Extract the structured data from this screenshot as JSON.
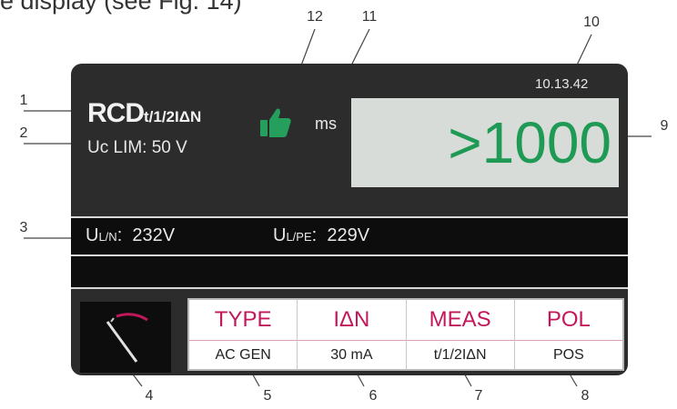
{
  "heading": "e display (see Fig. 14)",
  "callouts": [
    "1",
    "2",
    "3",
    "4",
    "5",
    "6",
    "7",
    "8",
    "9",
    "10",
    "11",
    "12"
  ],
  "screen": {
    "function_main": "RCD",
    "function_sub": "t/1/2IΔN",
    "uc_limit": "Uc LIM: 50 V",
    "time": "10.13.42",
    "unit": "ms",
    "result": ">1000",
    "result_color": "#1f9a55",
    "status_icon": "thumbs-up-icon",
    "voltage_1_label": "U",
    "voltage_1_sub": "L/N",
    "voltage_1_value": "232V",
    "voltage_2_label": "U",
    "voltage_2_sub": "L/PE",
    "voltage_2_value": "229V",
    "params": [
      {
        "header": "TYPE",
        "value": "AC GEN"
      },
      {
        "header": "IΔN",
        "value": "30 mA"
      },
      {
        "header": "MEAS",
        "value": "t/1/2IΔN"
      },
      {
        "header": "POL",
        "value": "POS"
      }
    ],
    "header_color": "#c2185b"
  }
}
